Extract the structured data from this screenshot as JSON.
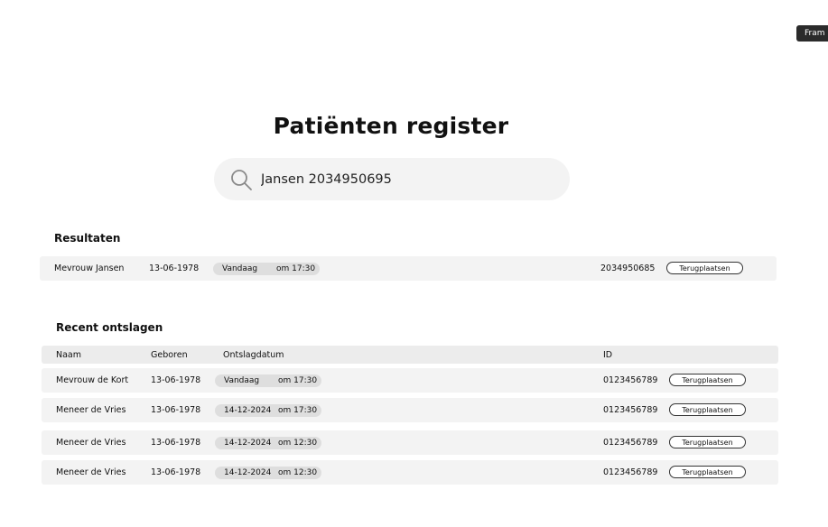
{
  "frame_label": "Fram",
  "page_title": "Patiënten register",
  "search": {
    "value": "Jansen 2034950695",
    "icon": "search-icon"
  },
  "results": {
    "title": "Resultaten",
    "rows": [
      {
        "name": "Mevrouw Jansen",
        "born": "13-06-1978",
        "date": "Vandaag",
        "time": "om 17:30",
        "id": "2034950685",
        "action": "Terugplaatsen"
      }
    ]
  },
  "recent": {
    "title": "Recent ontslagen",
    "columns": {
      "name": "Naam",
      "born": "Geboren",
      "discharge": "Ontslagdatum",
      "id": "ID"
    },
    "rows": [
      {
        "name": "Mevrouw de Kort",
        "born": "13-06-1978",
        "date": "Vandaag",
        "time": "om 17:30",
        "id": "0123456789",
        "action": "Terugplaatsen"
      },
      {
        "name": "Meneer de Vries",
        "born": "13-06-1978",
        "date": "14-12-2024",
        "time": "om 17:30",
        "id": "0123456789",
        "action": "Terugplaatsen"
      },
      {
        "name": "Meneer de Vries",
        "born": "13-06-1978",
        "date": "14-12-2024",
        "time": "om 12:30",
        "id": "0123456789",
        "action": "Terugplaatsen"
      },
      {
        "name": "Meneer de Vries",
        "born": "13-06-1978",
        "date": "14-12-2024",
        "time": "om 12:30",
        "id": "0123456789",
        "action": "Terugplaatsen"
      }
    ]
  }
}
